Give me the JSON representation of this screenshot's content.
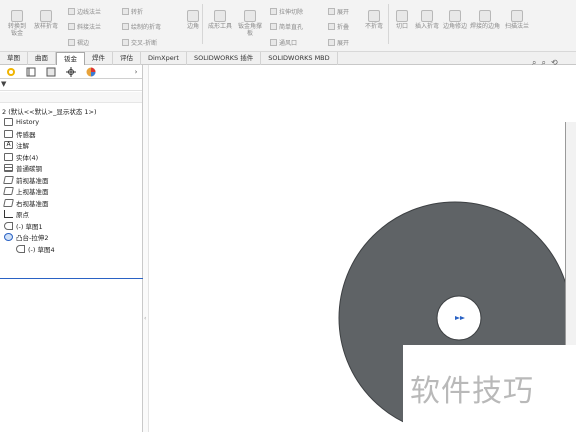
{
  "ribbon": {
    "buttons": [
      {
        "label": "转换到钣金",
        "icon": "convert-sheetmetal-icon"
      },
      {
        "label": "放样折弯",
        "icon": "lofted-bend-icon"
      },
      {
        "label": "边线法兰",
        "icon": "edge-flange-icon"
      },
      {
        "label": "斜接法兰",
        "icon": "miter-flange-icon"
      },
      {
        "label": "褶边",
        "icon": "hem-icon"
      },
      {
        "label": "转折",
        "icon": "jog-icon"
      },
      {
        "label": "绘制的折弯",
        "icon": "sketched-bend-icon"
      },
      {
        "label": "交叉-折断",
        "icon": "cross-break-icon"
      },
      {
        "label": "边角",
        "icon": "corners-icon"
      },
      {
        "label": "成形工具",
        "icon": "forming-tool-icon"
      },
      {
        "label": "钣金角撑板",
        "icon": "sheetmetal-gusset-icon"
      },
      {
        "label": "拉伸切除",
        "icon": "extruded-cut-icon"
      },
      {
        "label": "简单直孔",
        "icon": "simple-hole-icon"
      },
      {
        "label": "通风口",
        "icon": "vent-icon"
      },
      {
        "label": "展开",
        "icon": "unfold-icon"
      },
      {
        "label": "折叠",
        "icon": "fold-icon"
      },
      {
        "label": "展开",
        "icon": "flatten-icon"
      },
      {
        "label": "不折弯",
        "icon": "no-bends-icon"
      },
      {
        "label": "切口",
        "icon": "rip-icon"
      },
      {
        "label": "插入折弯",
        "icon": "insert-bends-icon"
      },
      {
        "label": "边角修边",
        "icon": "corner-trim-icon"
      },
      {
        "label": "焊接的边角",
        "icon": "welded-corner-icon"
      },
      {
        "label": "扫描法兰",
        "icon": "swept-flange-icon"
      }
    ]
  },
  "tabs": [
    "草图",
    "曲面",
    "钣金",
    "焊件",
    "评估",
    "DimXpert",
    "SOLIDWORKS 插件",
    "SOLIDWORKS MBD"
  ],
  "tree": {
    "root": "2 (默认<<默认>_显示状态 1>)",
    "items": [
      {
        "label": "History",
        "icon": "history-icon",
        "indent": 0
      },
      {
        "label": "传感器",
        "icon": "sensor-icon",
        "indent": 0
      },
      {
        "label": "注解",
        "icon": "annotation-icon",
        "indent": 0
      },
      {
        "label": "实体(4)",
        "icon": "solid-bodies-icon",
        "indent": 0
      },
      {
        "label": "普通碳钢",
        "icon": "material-icon",
        "indent": 0
      },
      {
        "label": "前视基准面",
        "icon": "plane-icon",
        "indent": 0
      },
      {
        "label": "上视基准面",
        "icon": "plane-icon",
        "indent": 0
      },
      {
        "label": "右视基准面",
        "icon": "plane-icon",
        "indent": 0
      },
      {
        "label": "原点",
        "icon": "origin-icon",
        "indent": 0
      },
      {
        "label": "(-) 草图1",
        "icon": "sketch-icon",
        "indent": 0
      },
      {
        "label": "凸台-拉伸2",
        "icon": "boss-extrude-icon",
        "indent": 0
      },
      {
        "label": "(-) 草图4",
        "icon": "sketch-icon",
        "indent": 1
      }
    ]
  },
  "watermark": "软件技巧",
  "colors": {
    "disk": "#5f6366",
    "hole": "#ffffff",
    "selection": "#2a62c4"
  }
}
